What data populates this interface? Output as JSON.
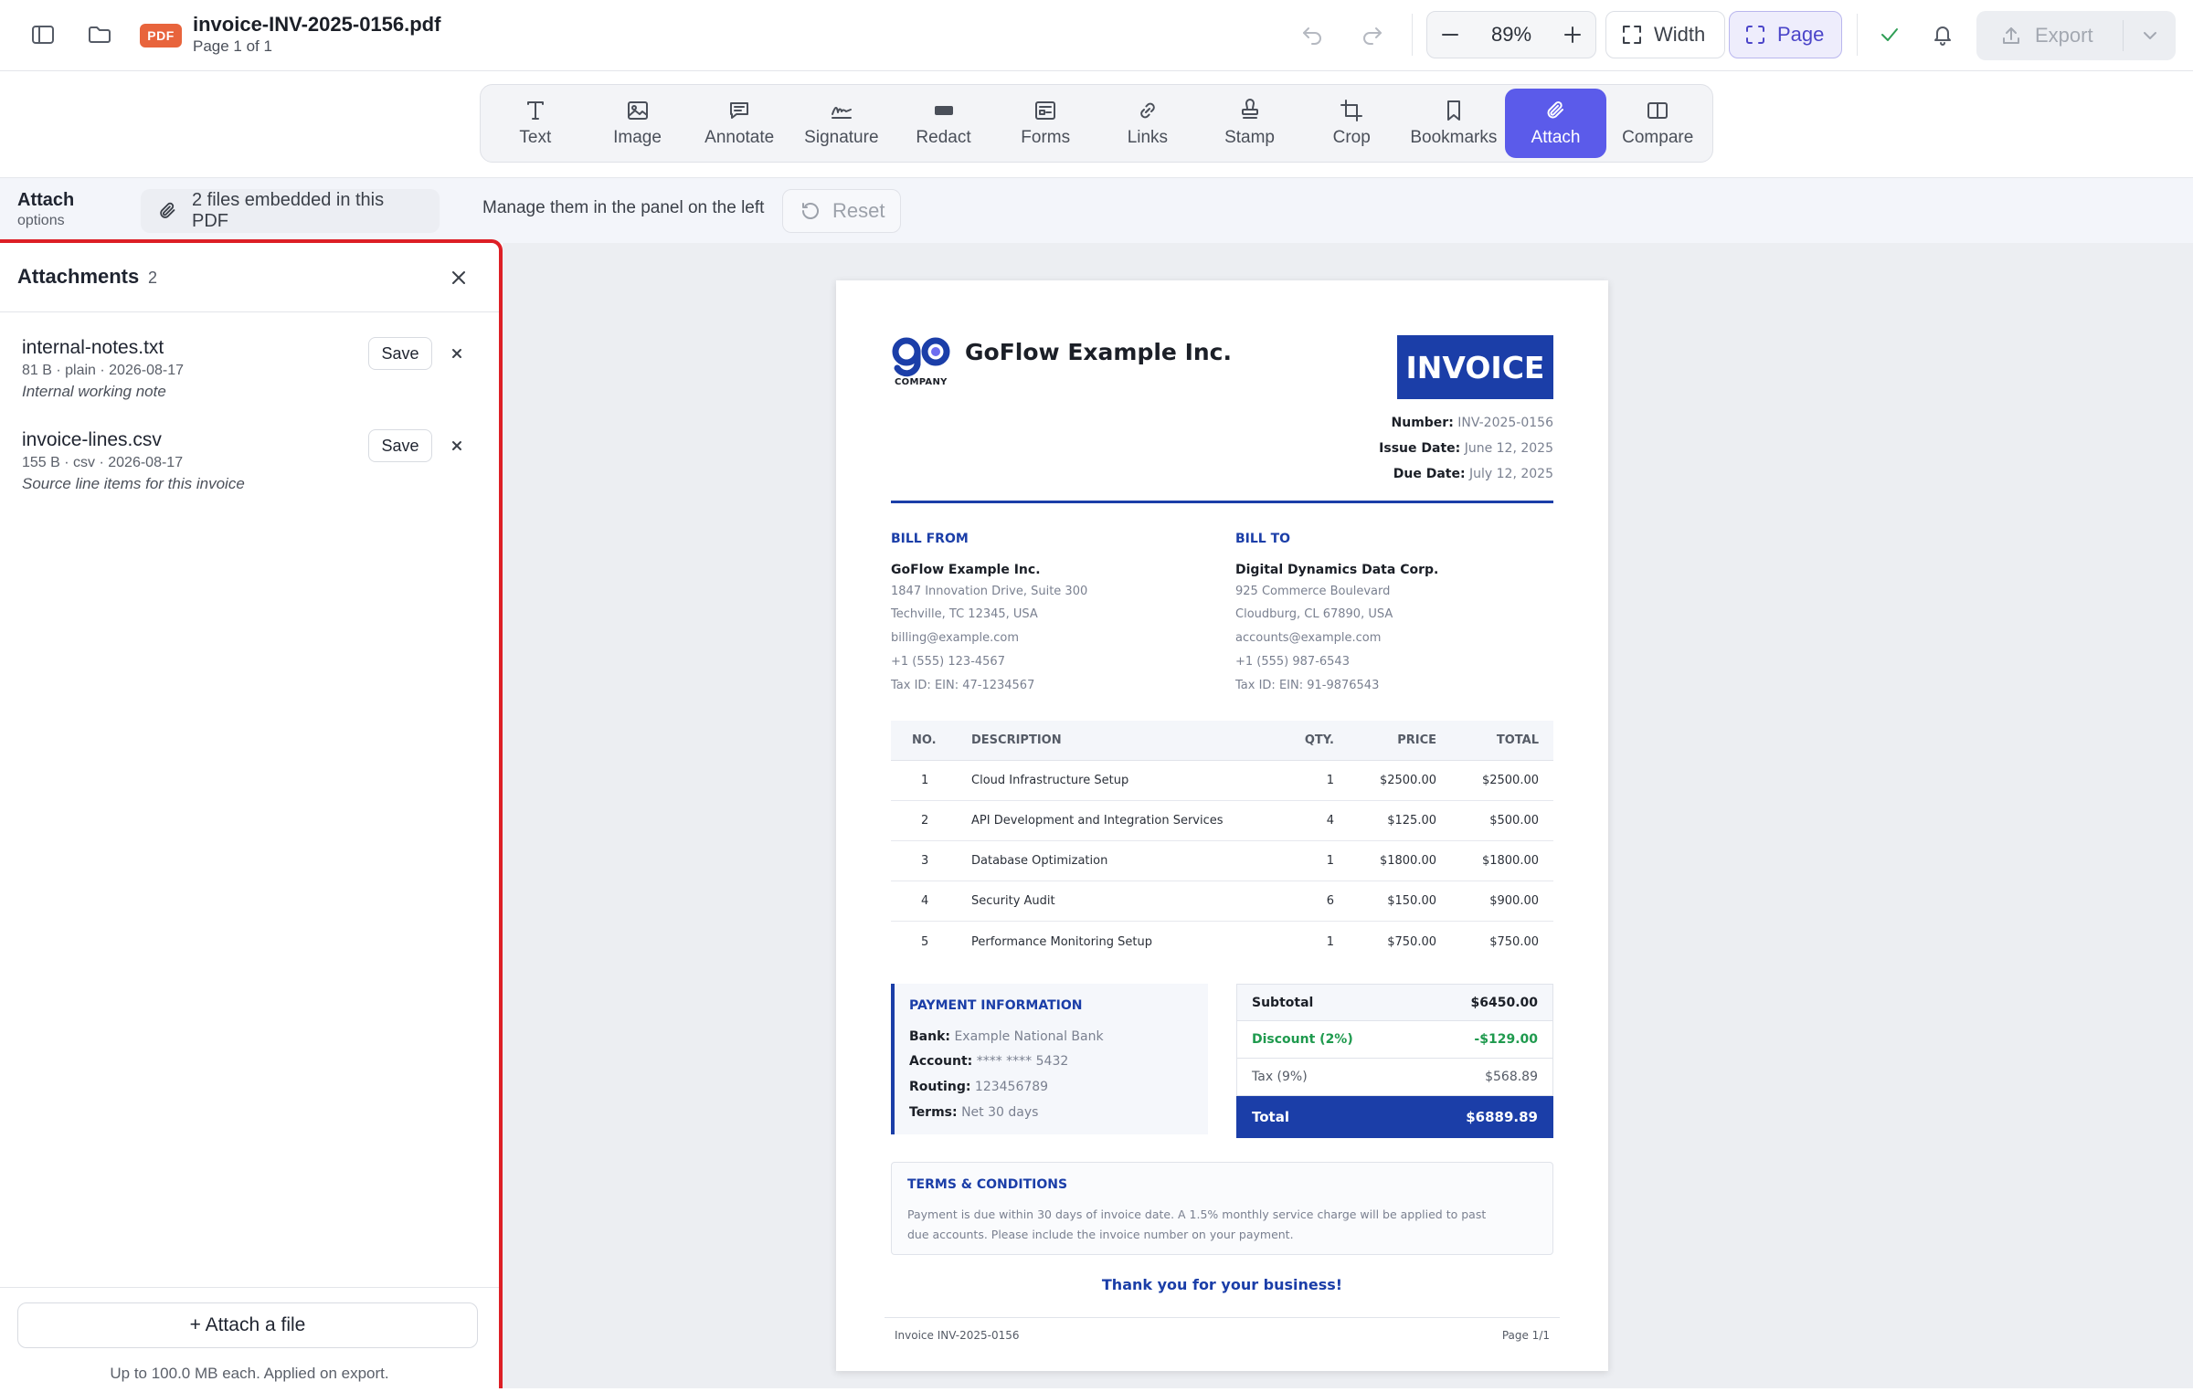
{
  "header": {
    "file_badge": "PDF",
    "file_name": "invoice-INV-2025-0156.pdf",
    "page_info": "Page 1 of 1",
    "zoom": "89%",
    "width_label": "Width",
    "page_label": "Page",
    "export_label": "Export"
  },
  "tools": [
    {
      "label": "Text",
      "icon": "text-icon"
    },
    {
      "label": "Image",
      "icon": "image-icon"
    },
    {
      "label": "Annotate",
      "icon": "comment-icon"
    },
    {
      "label": "Signature",
      "icon": "signature-icon"
    },
    {
      "label": "Redact",
      "icon": "redact-icon"
    },
    {
      "label": "Forms",
      "icon": "form-icon"
    },
    {
      "label": "Links",
      "icon": "link-icon"
    },
    {
      "label": "Stamp",
      "icon": "stamp-icon"
    },
    {
      "label": "Crop",
      "icon": "crop-icon"
    },
    {
      "label": "Bookmarks",
      "icon": "bookmark-icon"
    },
    {
      "label": "Attach",
      "icon": "paperclip-icon",
      "active": true
    },
    {
      "label": "Compare",
      "icon": "compare-icon"
    }
  ],
  "options": {
    "title": "Attach",
    "subtitle": "options",
    "chip": "2 files embedded in this PDF",
    "hint": "Manage them in the panel on the left",
    "reset": "Reset"
  },
  "panel": {
    "title": "Attachments",
    "count": "2",
    "save_label": "Save",
    "attachments": [
      {
        "name": "internal-notes.txt",
        "meta": "81 B · plain · 2026-08-17",
        "desc": "Internal working note"
      },
      {
        "name": "invoice-lines.csv",
        "meta": "155 B · csv · 2026-08-17",
        "desc": "Source line items for this invoice"
      }
    ],
    "attach_button": "+ Attach a file",
    "footer_note": "Up to 100.0 MB each. Applied on export."
  },
  "invoice": {
    "logo_caption": "COMPANY",
    "company": "GoFlow Example Inc.",
    "title": "INVOICE",
    "number_label": "Number:",
    "number": "INV-2025-0156",
    "issue_label": "Issue Date:",
    "issue_date": "June 12, 2025",
    "due_label": "Due Date:",
    "due_date": "July 12, 2025",
    "bill_from": {
      "heading": "BILL FROM",
      "name": "GoFlow Example Inc.",
      "lines": [
        "1847 Innovation Drive, Suite 300",
        "Techville, TC 12345, USA",
        "billing@example.com",
        "+1 (555) 123-4567",
        "Tax ID: EIN: 47-1234567"
      ]
    },
    "bill_to": {
      "heading": "BILL TO",
      "name": "Digital Dynamics Data Corp.",
      "lines": [
        "925 Commerce Boulevard",
        "Cloudburg, CL 67890, USA",
        "accounts@example.com",
        "+1 (555) 987-6543",
        "Tax ID: EIN: 91-9876543"
      ]
    },
    "columns": [
      "NO.",
      "DESCRIPTION",
      "QTY.",
      "PRICE",
      "TOTAL"
    ],
    "rows": [
      [
        "1",
        "Cloud Infrastructure Setup",
        "1",
        "$2500.00",
        "$2500.00"
      ],
      [
        "2",
        "API Development and Integration Services",
        "4",
        "$125.00",
        "$500.00"
      ],
      [
        "3",
        "Database Optimization",
        "1",
        "$1800.00",
        "$1800.00"
      ],
      [
        "4",
        "Security Audit",
        "6",
        "$150.00",
        "$900.00"
      ],
      [
        "5",
        "Performance Monitoring Setup",
        "1",
        "$750.00",
        "$750.00"
      ]
    ],
    "payment": {
      "heading": "PAYMENT INFORMATION",
      "bank_label": "Bank:",
      "bank": "Example National Bank",
      "account_label": "Account:",
      "account": "**** **** 5432",
      "routing_label": "Routing:",
      "routing": "123456789",
      "terms_label": "Terms:",
      "terms": "Net 30 days"
    },
    "totals": {
      "subtotal_label": "Subtotal",
      "subtotal": "$6450.00",
      "discount_label": "Discount (2%)",
      "discount": "-$129.00",
      "tax_label": "Tax (9%)",
      "tax": "$568.89",
      "total_label": "Total",
      "total": "$6889.89"
    },
    "terms_heading": "TERMS & CONDITIONS",
    "terms_text": "Payment is due within 30 days of invoice date. A 1.5% monthly service charge will be applied to past due accounts. Please include the invoice number on your payment.",
    "thanks": "Thank you for your business!",
    "footer_left": "Invoice INV-2025-0156",
    "footer_right": "Page 1/1"
  },
  "colors": {
    "accent": "#5b5bea",
    "invoice_blue": "#1b3ea8",
    "highlight_border": "#dd1f26",
    "pdf_badge": "#e8643c",
    "discount_green": "#1f9a4e"
  }
}
